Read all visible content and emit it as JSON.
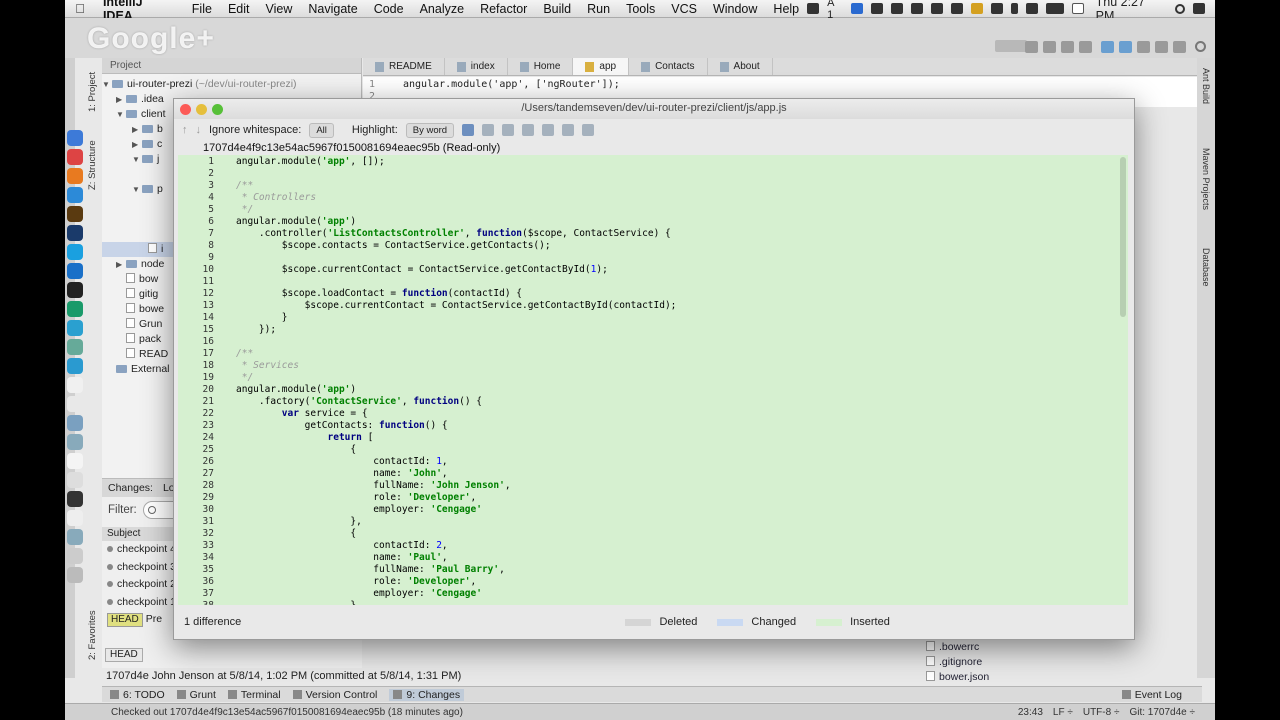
{
  "menubar": {
    "app": "IntelliJ IDEA",
    "items": [
      "File",
      "Edit",
      "View",
      "Navigate",
      "Code",
      "Analyze",
      "Refactor",
      "Build",
      "Run",
      "Tools",
      "VCS",
      "Window",
      "Help"
    ],
    "clock": "Thu 2:27 PM",
    "status_text": "A 1"
  },
  "overlay": {
    "google_plus": "Google+"
  },
  "project": {
    "header": "Project",
    "root": "ui-router-prezi",
    "root_path": "(~/dev/ui-router-prezi)",
    "items": [
      ".idea",
      "client",
      "node",
      "bow",
      "gitig",
      "bowe",
      "Grun",
      "pack",
      "READ",
      "External"
    ]
  },
  "editor_tabs": [
    {
      "label": "README"
    },
    {
      "label": "index"
    },
    {
      "label": "Home"
    },
    {
      "label": "app",
      "active": true
    },
    {
      "label": "Contacts"
    },
    {
      "label": "About"
    }
  ],
  "behind_editor": {
    "lines": [
      {
        "n": "1",
        "text": "angular.module('app', ['ngRouter']);"
      },
      {
        "n": "2",
        "text": ""
      }
    ]
  },
  "diff": {
    "title": "/Users/tandemseven/dev/ui-router-prezi/client/js/app.js",
    "ignore_label": "Ignore whitespace:",
    "ignore_value": "All",
    "highlight_label": "Highlight:",
    "highlight_value": "By word",
    "revision": "1707d4e4f9c13e54ac5967f0150081694eaec95b (Read-only)",
    "footer_count": "1 difference",
    "legend": [
      "Deleted",
      "Changed",
      "Inserted"
    ],
    "code": [
      {
        "n": "1",
        "t": "angular.module('app', []);"
      },
      {
        "n": "2",
        "t": ""
      },
      {
        "n": "3",
        "t": "/**"
      },
      {
        "n": "4",
        "t": " * Controllers"
      },
      {
        "n": "5",
        "t": " */"
      },
      {
        "n": "6",
        "t": "angular.module('app')"
      },
      {
        "n": "7",
        "t": "    .controller('ListContactsController', function($scope, ContactService) {"
      },
      {
        "n": "8",
        "t": "        $scope.contacts = ContactService.getContacts();"
      },
      {
        "n": "9",
        "t": ""
      },
      {
        "n": "10",
        "t": "        $scope.currentContact = ContactService.getContactById(1);"
      },
      {
        "n": "11",
        "t": ""
      },
      {
        "n": "12",
        "t": "        $scope.loadContact = function(contactId) {"
      },
      {
        "n": "13",
        "t": "            $scope.currentContact = ContactService.getContactById(contactId);"
      },
      {
        "n": "14",
        "t": "        }"
      },
      {
        "n": "15",
        "t": "    });"
      },
      {
        "n": "16",
        "t": ""
      },
      {
        "n": "17",
        "t": "/**"
      },
      {
        "n": "18",
        "t": " * Services"
      },
      {
        "n": "19",
        "t": " */"
      },
      {
        "n": "20",
        "t": "angular.module('app')"
      },
      {
        "n": "21",
        "t": "    .factory('ContactService', function() {"
      },
      {
        "n": "22",
        "t": "        var service = {"
      },
      {
        "n": "23",
        "t": "            getContacts: function() {"
      },
      {
        "n": "24",
        "t": "                return ["
      },
      {
        "n": "25",
        "t": "                    {"
      },
      {
        "n": "26",
        "t": "                        contactId: 1,"
      },
      {
        "n": "27",
        "t": "                        name: 'John',"
      },
      {
        "n": "28",
        "t": "                        fullName: 'John Jenson',"
      },
      {
        "n": "29",
        "t": "                        role: 'Developer',"
      },
      {
        "n": "30",
        "t": "                        employer: 'Cengage'"
      },
      {
        "n": "31",
        "t": "                    },"
      },
      {
        "n": "32",
        "t": "                    {"
      },
      {
        "n": "33",
        "t": "                        contactId: 2,"
      },
      {
        "n": "34",
        "t": "                        name: 'Paul',"
      },
      {
        "n": "35",
        "t": "                        fullName: 'Paul Barry',"
      },
      {
        "n": "36",
        "t": "                        role: 'Developer',"
      },
      {
        "n": "37",
        "t": "                        employer: 'Cengage'"
      },
      {
        "n": "38",
        "t": "                    }"
      }
    ]
  },
  "changes": {
    "tab_changes": "Changes:",
    "tab_log": "Lo",
    "filter_label": "Filter:",
    "subject_header": "Subject",
    "commits": [
      "checkpoint 4",
      "checkpoint 3",
      "checkpoint 2",
      "checkpoint 1"
    ],
    "head_label": "HEAD",
    "head_text": "Pre"
  },
  "commit_info": "1707d4e John Jenson at 5/8/14, 1:02 PM (committed at 5/8/14, 1:31 PM)",
  "head_badge": "HEAD",
  "right_files": [
    ".bowerrc",
    ".gitignore",
    "bower.json"
  ],
  "bottom_tabs": [
    "6: TODO",
    "Grunt",
    "Terminal",
    "Version Control",
    "9: Changes"
  ],
  "event_log": "Event Log",
  "status": {
    "message": "Checked out 1707d4e4f9c13e54ac5967f0150081694eaec95b (18 minutes ago)",
    "position": "23:43",
    "line_sep": "LF ÷",
    "encoding": "UTF-8 ÷",
    "git": "Git: 1707d4e ÷"
  },
  "side_tabs": {
    "project": "1: Project",
    "structure": "Z: Structure",
    "favorites": "2: Favorites",
    "ant": "Ant Build",
    "maven": "Maven Projects",
    "database": "Database"
  },
  "colors": {
    "inserted": "#d6f0d0",
    "changed": "#c9d9f2",
    "deleted": "#d5d5d5"
  }
}
